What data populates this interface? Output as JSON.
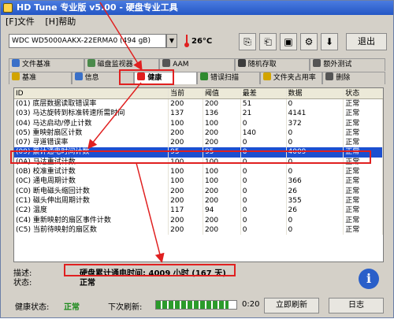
{
  "window": {
    "title": "HD Tune 专业版 v5.00 - 硬盘专业工具"
  },
  "menu": [
    "[F]文件",
    "[H]帮助"
  ],
  "toolbar": {
    "drive": "WDC WD5000AAKX-22ERMA0 (494 gB)",
    "temperature": "26°C",
    "exit_label": "退出"
  },
  "tabs_row1": [
    {
      "label": "文件基准",
      "icon": "file-icon",
      "color": "#3a70c8"
    },
    {
      "label": "磁盘监视器",
      "icon": "monitor-icon",
      "color": "#4a8a4a"
    },
    {
      "label": "AAM",
      "icon": "speaker-icon",
      "color": "#555555"
    },
    {
      "label": "随机存取",
      "icon": "random-icon",
      "color": "#3c3c3c"
    },
    {
      "label": "额外测试",
      "icon": "extra-icon",
      "color": "#555555"
    }
  ],
  "tabs_row2": [
    {
      "label": "基准",
      "icon": "benchmark-icon",
      "color": "#d2a400"
    },
    {
      "label": "信息",
      "icon": "info-icon",
      "color": "#3a70c8"
    },
    {
      "label": "健康",
      "icon": "health-icon",
      "color": "#e02020",
      "active": true
    },
    {
      "label": "错误扫描",
      "icon": "scan-icon",
      "color": "#2f8a2f"
    },
    {
      "label": "文件夹占用率",
      "icon": "folder-icon",
      "color": "#d2a400"
    },
    {
      "label": "删除",
      "icon": "delete-icon",
      "color": "#555555"
    }
  ],
  "grid": {
    "headers": [
      "ID",
      "当前",
      "阈值",
      "最差",
      "数据",
      "状态"
    ],
    "rows": [
      [
        "(01) 底层数据读取错误率",
        "200",
        "200",
        "51",
        "0",
        "正常"
      ],
      [
        "(03) 马达旋转到标准转速所需时间",
        "137",
        "136",
        "21",
        "4141",
        "正常"
      ],
      [
        "(04) 马达启动/停止计数",
        "100",
        "100",
        "0",
        "372",
        "正常"
      ],
      [
        "(05) 重映射扇区计数",
        "200",
        "200",
        "140",
        "0",
        "正常"
      ],
      [
        "(07) 寻道错误率",
        "200",
        "200",
        "0",
        "0",
        "正常"
      ],
      [
        "(09) 累计通电时间计数",
        "95",
        "95",
        "0",
        "4009",
        "正常"
      ],
      [
        "(0A) 马达重试计数",
        "100",
        "100",
        "0",
        "0",
        "正常"
      ],
      [
        "(0B) 校准重试计数",
        "100",
        "100",
        "0",
        "0",
        "正常"
      ],
      [
        "(0C) 通电周期计数",
        "100",
        "100",
        "0",
        "366",
        "正常"
      ],
      [
        "(C0) 断电磁头缩回计数",
        "200",
        "200",
        "0",
        "26",
        "正常"
      ],
      [
        "(C1) 磁头伸出周期计数",
        "200",
        "200",
        "0",
        "355",
        "正常"
      ],
      [
        "(C2) 温度",
        "117",
        "94",
        "0",
        "26",
        "正常"
      ],
      [
        "(C4) 重新映射的扇区事件计数",
        "200",
        "200",
        "0",
        "0",
        "正常"
      ],
      [
        "(C5) 当前待映射的扇区数",
        "200",
        "200",
        "0",
        "0",
        "正常"
      ]
    ],
    "selected_index": 5
  },
  "description": {
    "desc_label": "描述:",
    "status_label": "状态:",
    "desc_value": "硬盘累计通电时间: 4009 小时 (167 天)",
    "status_value": "正常"
  },
  "statusbar": {
    "health_label": "健康状态:",
    "health_value": "正常",
    "next_refresh_label": "下次刷新:",
    "countdown": "0:20",
    "refresh_label": "立即刷新",
    "log_label": "日志",
    "progress": 0.9
  }
}
